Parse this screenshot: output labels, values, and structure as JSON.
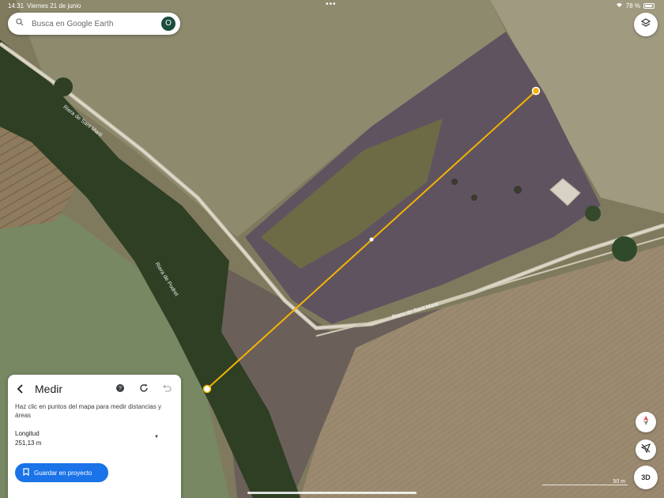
{
  "status": {
    "time": "14:31",
    "date": "Viernes 21 de junio",
    "dots": "•••",
    "battery": "78 %"
  },
  "search": {
    "placeholder": "Busca en Google Earth",
    "avatar_letter": "O"
  },
  "roads": {
    "road_a": "Riera de Sant Martí",
    "road_b": "Riera de Podret",
    "road_c": "Riera de Sant Martí"
  },
  "measure_panel": {
    "title": "Medir",
    "description": "Haz clic en puntos del mapa para medir distancias y áreas",
    "length_label": "Longitud",
    "length_value": "251,13 m",
    "save_label": "Guardar en proyecto"
  },
  "map_controls": {
    "three_d_label": "3D",
    "scale_label": "50 m"
  },
  "colors": {
    "accent": "#1a73e8",
    "measure_line": "#f4b400",
    "avatar_bg": "#1b4d3e"
  }
}
